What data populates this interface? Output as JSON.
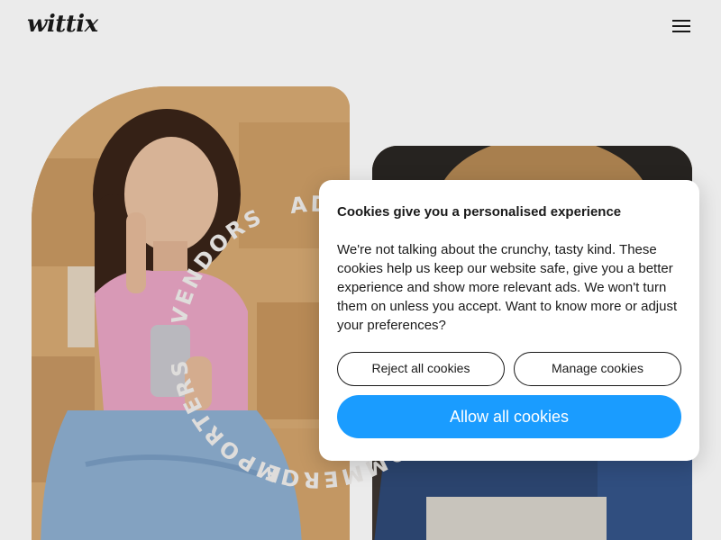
{
  "header": {
    "logo": "wittix",
    "menu_icon": "hamburger-menu-icon"
  },
  "hero": {
    "rotating_words": [
      "ADVERTISERS",
      "VENDORS",
      "IMPORTERS",
      "E-COMMERCE"
    ],
    "left_photo": "woman-phone-photo",
    "right_photo": "man-laptop-photo"
  },
  "cookie_dialog": {
    "title": "Cookies give you a personalised experience",
    "body": "We're not talking about the crunchy, tasty kind. These cookies help us keep our website safe, give you a better experience and show more relevant ads. We won't turn them on unless you accept. Want to know more or adjust your preferences?",
    "reject_label": "Reject all cookies",
    "manage_label": "Manage cookies",
    "allow_label": "Allow all cookies",
    "accent_color": "#1a9cff"
  }
}
